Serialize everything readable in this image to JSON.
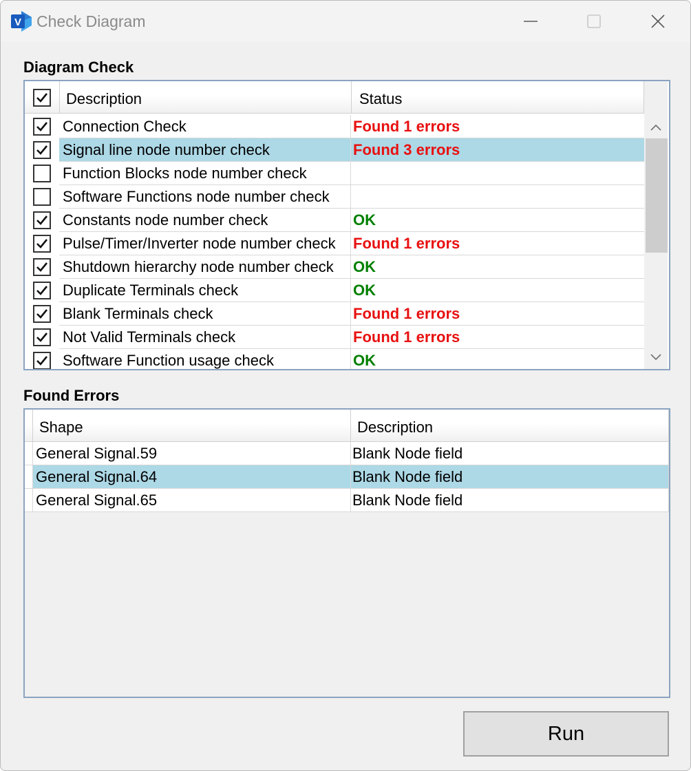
{
  "window": {
    "title": "Check Diagram",
    "app_icon_letter": "V",
    "icon_colors": {
      "front": "#185abd",
      "back": "#41a5ee"
    }
  },
  "diagram_check": {
    "label": "Diagram Check",
    "header_all_checked": true,
    "columns": {
      "description": "Description",
      "status": "Status"
    },
    "selected_row_color": "#add8e6",
    "status_colors": {
      "error": "#e81010",
      "ok": "#008000"
    },
    "rows": [
      {
        "checked": true,
        "description": "Connection Check",
        "status": "Found 1 errors",
        "kind": "error",
        "selected": false
      },
      {
        "checked": true,
        "description": "Signal line node number check",
        "status": "Found 3 errors",
        "kind": "error",
        "selected": true
      },
      {
        "checked": false,
        "description": "Function Blocks node number check",
        "status": "",
        "kind": "",
        "selected": false
      },
      {
        "checked": false,
        "description": "Software Functions node number check",
        "status": "",
        "kind": "",
        "selected": false
      },
      {
        "checked": true,
        "description": "Constants node number check",
        "status": "OK",
        "kind": "ok",
        "selected": false
      },
      {
        "checked": true,
        "description": "Pulse/Timer/Inverter node number check",
        "status": "Found 1 errors",
        "kind": "error",
        "selected": false
      },
      {
        "checked": true,
        "description": "Shutdown hierarchy node number check",
        "status": "OK",
        "kind": "ok",
        "selected": false
      },
      {
        "checked": true,
        "description": "Duplicate Terminals check",
        "status": "OK",
        "kind": "ok",
        "selected": false
      },
      {
        "checked": true,
        "description": "Blank Terminals check",
        "status": "Found 1 errors",
        "kind": "error",
        "selected": false
      },
      {
        "checked": true,
        "description": "Not Valid Terminals check",
        "status": "Found 1 errors",
        "kind": "error",
        "selected": false
      },
      {
        "checked": true,
        "description": "Software Function usage check",
        "status": "OK",
        "kind": "ok",
        "selected": false
      }
    ]
  },
  "found_errors": {
    "label": "Found Errors",
    "columns": {
      "shape": "Shape",
      "description": "Description"
    },
    "rows": [
      {
        "shape": "General Signal.59",
        "description": "Blank Node field",
        "selected": false
      },
      {
        "shape": "General Signal.64",
        "description": "Blank Node field",
        "selected": true
      },
      {
        "shape": "General Signal.65",
        "description": "Blank Node field",
        "selected": false
      }
    ]
  },
  "run_label": "Run"
}
